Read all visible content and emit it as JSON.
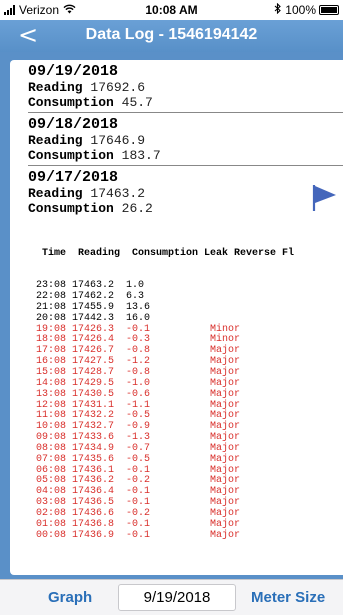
{
  "status": {
    "carrier": "Verizon",
    "time": "10:08 AM",
    "battery": "100%",
    "bluetooth": "bluetooth-icon"
  },
  "nav": {
    "back": "<",
    "title": "Data Log - 1546194142"
  },
  "days": [
    {
      "date": "09/19/2018",
      "reading_label": "Reading",
      "reading": "17692.6",
      "consumption_label": "Consumption",
      "consumption": "45.7"
    },
    {
      "date": "09/18/2018",
      "reading_label": "Reading",
      "reading": "17646.9",
      "consumption_label": "Consumption",
      "consumption": "183.7"
    },
    {
      "date": "09/17/2018",
      "reading_label": "Reading",
      "reading": "17463.2",
      "consumption_label": "Consumption",
      "consumption": "26.2",
      "flag_icon": "flag-icon",
      "flag_color": "#4466bb"
    }
  ],
  "table": {
    "header": " Time  Reading  Consumption Leak Reverse Fl",
    "rows": [
      {
        "text": "23:08 17463.2  1.0",
        "alert": false
      },
      {
        "text": "22:08 17462.2  6.3",
        "alert": false
      },
      {
        "text": "21:08 17455.9  13.6",
        "alert": false
      },
      {
        "text": "20:08 17442.3  16.0",
        "alert": false
      },
      {
        "text": "19:08 17426.3  -0.1          Minor",
        "alert": true
      },
      {
        "text": "18:08 17426.4  -0.3          Minor",
        "alert": true
      },
      {
        "text": "17:08 17426.7  -0.8          Major",
        "alert": true
      },
      {
        "text": "16:08 17427.5  -1.2          Major",
        "alert": true
      },
      {
        "text": "15:08 17428.7  -0.8          Major",
        "alert": true
      },
      {
        "text": "14:08 17429.5  -1.0          Major",
        "alert": true
      },
      {
        "text": "13:08 17430.5  -0.6          Major",
        "alert": true
      },
      {
        "text": "12:08 17431.1  -1.1          Major",
        "alert": true
      },
      {
        "text": "11:08 17432.2  -0.5          Major",
        "alert": true
      },
      {
        "text": "10:08 17432.7  -0.9          Major",
        "alert": true
      },
      {
        "text": "09:08 17433.6  -1.3          Major",
        "alert": true
      },
      {
        "text": "08:08 17434.9  -0.7          Major",
        "alert": true
      },
      {
        "text": "07:08 17435.6  -0.5          Major",
        "alert": true
      },
      {
        "text": "06:08 17436.1  -0.1          Major",
        "alert": true
      },
      {
        "text": "05:08 17436.2  -0.2          Major",
        "alert": true
      },
      {
        "text": "04:08 17436.4  -0.1          Major",
        "alert": true
      },
      {
        "text": "03:08 17436.5  -0.1          Major",
        "alert": true
      },
      {
        "text": "02:08 17436.6  -0.2          Major",
        "alert": true
      },
      {
        "text": "01:08 17436.8  -0.1          Major",
        "alert": true
      },
      {
        "text": "00:08 17436.9  -0.1          Major",
        "alert": true
      }
    ],
    "alert_color": "#d9302c"
  },
  "bottom": {
    "graph": "Graph",
    "date": "9/19/2018",
    "meter_size": "Meter Size",
    "accent": "#2a6fb8"
  }
}
